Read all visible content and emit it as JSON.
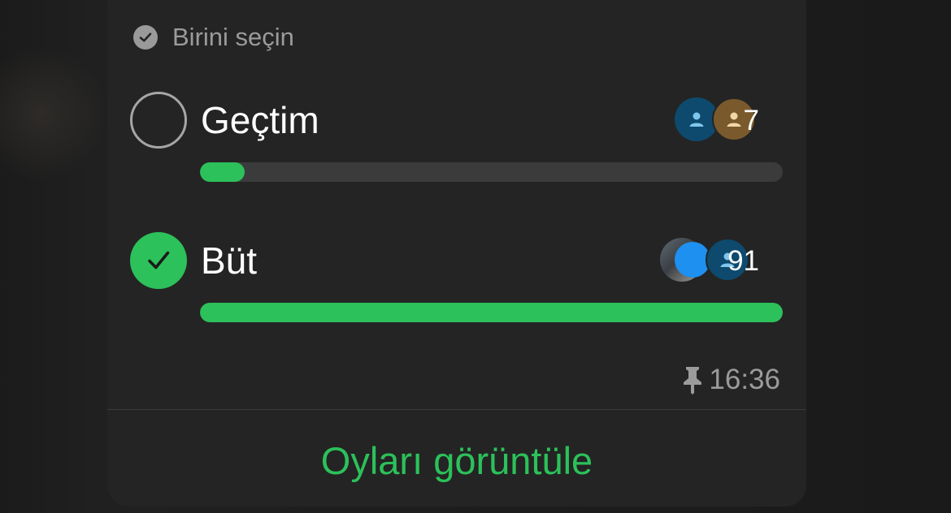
{
  "poll": {
    "mode_label": "Birini seçin",
    "options": [
      {
        "label": "Geçtim",
        "votes": "7",
        "fraction": 0.077,
        "selected": false
      },
      {
        "label": "Büt",
        "votes": "91",
        "fraction": 1.0,
        "selected": true
      }
    ],
    "time": "16:36",
    "view_votes_label": "Oyları görüntüle"
  },
  "colors": {
    "accent": "#2cc15a",
    "card": "#242424",
    "muted": "#9b9b9b"
  },
  "icons": [
    "check-circle-icon",
    "radio-empty-icon",
    "radio-checked-icon",
    "avatar-placeholder-icon",
    "pin-icon"
  ]
}
